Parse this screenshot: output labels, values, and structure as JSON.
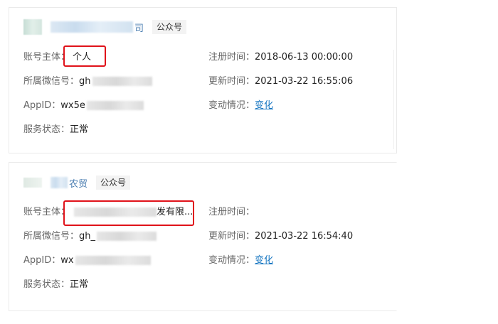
{
  "accounts": [
    {
      "name_suffix": "司",
      "type": "公众号",
      "owner_label": "账号主体：",
      "owner_value": "个人",
      "wechat_id_label": "所属微信号：",
      "wechat_id_prefix": "gh",
      "appid_label": "AppID：",
      "appid_prefix": "wx5e",
      "status_label": "服务状态：",
      "status_value": "正常",
      "registered_label": "注册时间：",
      "registered_value": "2018-06-13 00:00:00",
      "updated_label": "更新时间：",
      "updated_value": "2021-03-22 16:55:06",
      "change_label": "变动情况：",
      "change_link": "变化"
    },
    {
      "name_suffix": "农贸",
      "type": "公众号",
      "owner_label": "账号主体：",
      "owner_value": "发有限...",
      "wechat_id_label": "所属微信号：",
      "wechat_id_prefix": "gh_",
      "appid_label": "AppID：",
      "appid_prefix": "wx",
      "status_label": "服务状态：",
      "status_value": "正常",
      "registered_label": "注册时间：",
      "registered_value": "",
      "updated_label": "更新时间：",
      "updated_value": "2021-03-22 16:54:40",
      "change_label": "变动情况：",
      "change_link": "变化"
    }
  ],
  "colors": {
    "highlight_box": "#e0121a",
    "link": "#1a78c2",
    "name": "#4d7fb2"
  }
}
